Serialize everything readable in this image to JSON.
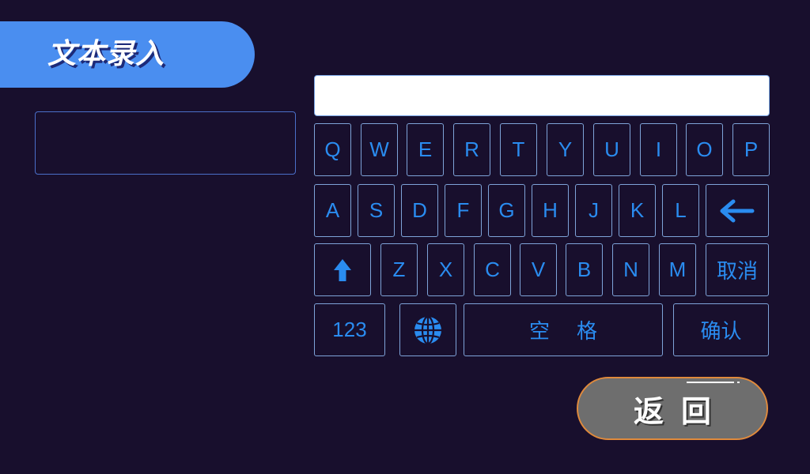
{
  "header": {
    "title": "文本录入"
  },
  "input": {
    "value": ""
  },
  "keyboard": {
    "row1": [
      "Q",
      "W",
      "E",
      "R",
      "T",
      "Y",
      "U",
      "I",
      "O",
      "P"
    ],
    "row2": [
      "A",
      "S",
      "D",
      "F",
      "G",
      "H",
      "J",
      "K",
      "L"
    ],
    "row3": [
      "Z",
      "X",
      "C",
      "V",
      "B",
      "N",
      "M"
    ],
    "cancel_label": "取消",
    "numbers_label": "123",
    "space_label": "空格",
    "confirm_label": "确认",
    "key_color": "#2a8cf0",
    "key_border_color": "#7ea3d8"
  },
  "footer": {
    "back_label": "返回"
  },
  "colors": {
    "background": "#180f2d",
    "title_tab": "#4a8ef0",
    "back_button": "#6e6e6e",
    "back_border": "#e08a3c"
  }
}
